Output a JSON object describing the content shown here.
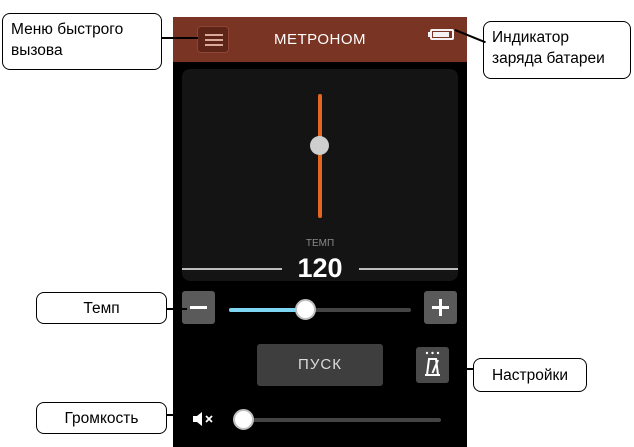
{
  "screen": {
    "title": "МЕТРОНОМ",
    "battery_level": 0.9,
    "tempo_caption": "ТЕМП",
    "tempo_value": "120",
    "tempo_slider_position": 0.42,
    "start_label": "ПУСК",
    "volume_slider_position": 0.0
  },
  "callouts": {
    "quick_menu": "Меню быстрого\nвызова",
    "battery": "Индикатор\nзаряда батареи",
    "tempo": "Темп",
    "settings": "Настройки",
    "volume": "Громкость"
  },
  "icons": {
    "menu": "hamburger-icon",
    "battery": "battery-icon",
    "minus": "minus-icon",
    "plus": "plus-icon",
    "settings": "metronome-settings-icon",
    "volume": "speaker-muted-icon"
  },
  "colors": {
    "titlebar": "#7a3423",
    "pendulum": "#e6661e",
    "slider_fill": "#7fd6f2",
    "screen_bg": "#000000"
  }
}
